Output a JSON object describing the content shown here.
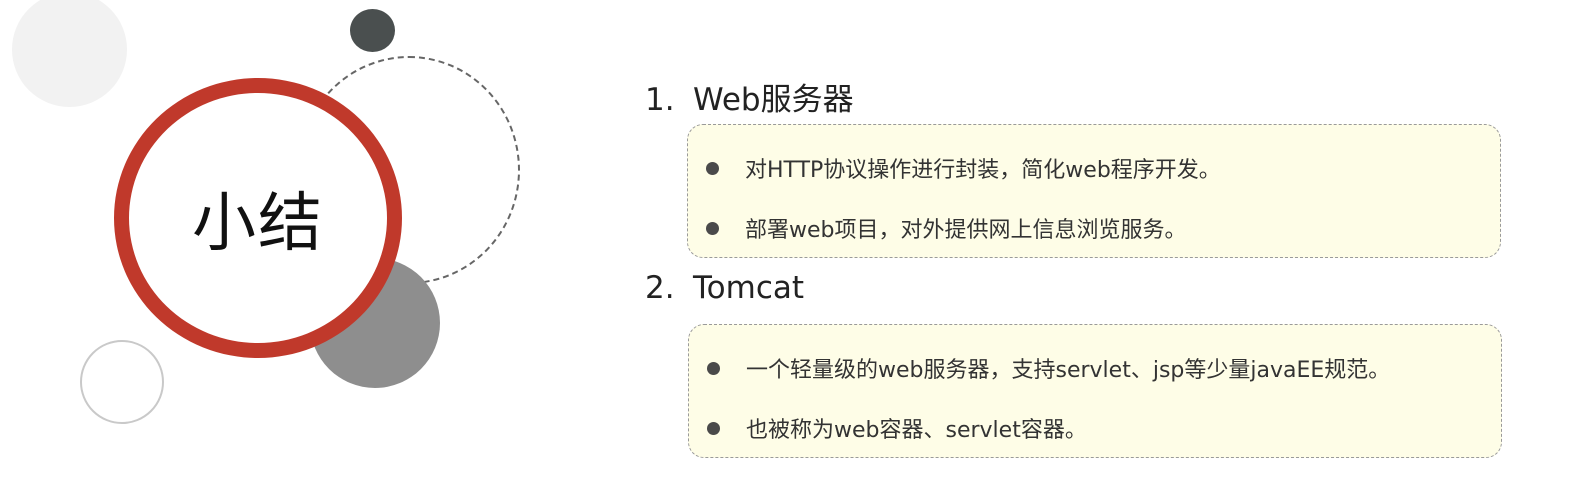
{
  "slide": {
    "title": "小结",
    "sections": [
      {
        "number": "1.",
        "heading": "Web服务器",
        "bullets": [
          "对HTTP协议操作进行封装，简化web程序开发。",
          "部署web项目，对外提供网上信息浏览服务。"
        ]
      },
      {
        "number": "2.",
        "heading": "Tomcat",
        "bullets": [
          "一个轻量级的web服务器，支持servlet、jsp等少量javaEE规范。",
          "也被称为web容器、servlet容器。"
        ]
      }
    ]
  },
  "colors": {
    "accent_ring": "#c0392b",
    "box_background": "#fefde7",
    "bullet": "#4a4a4a"
  }
}
